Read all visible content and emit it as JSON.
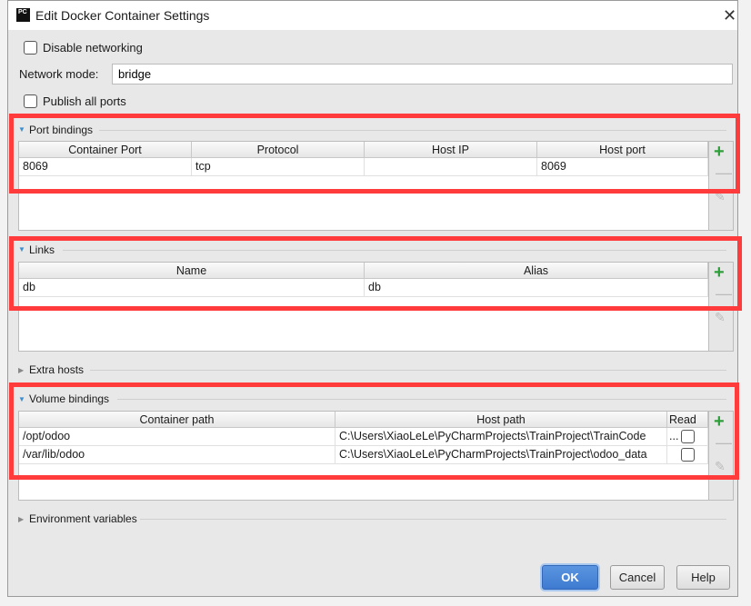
{
  "dialog": {
    "title": "Edit Docker Container Settings",
    "app_icon": "PC",
    "close": "✕"
  },
  "disable_networking": {
    "label": "Disable networking",
    "checked": false
  },
  "network_mode": {
    "label": "Network mode:",
    "value": "bridge"
  },
  "publish_all": {
    "label": "Publish all ports",
    "checked": false
  },
  "port_bindings": {
    "title": "Port bindings",
    "expanded": true,
    "columns": [
      "Container Port",
      "Protocol",
      "Host IP",
      "Host port"
    ],
    "rows": [
      [
        "8069",
        "tcp",
        "",
        "8069"
      ]
    ]
  },
  "links": {
    "title": "Links",
    "expanded": true,
    "columns": [
      "Name",
      "Alias"
    ],
    "rows": [
      [
        "db",
        "db"
      ]
    ]
  },
  "extra_hosts": {
    "title": "Extra hosts",
    "expanded": false
  },
  "volume_bindings": {
    "title": "Volume bindings",
    "expanded": true,
    "columns": [
      "Container path",
      "Host path",
      "Read ..."
    ],
    "rows": [
      [
        "/opt/odoo",
        "C:\\Users\\XiaoLeLe\\PyCharmProjects\\TrainProject\\TrainCode",
        false
      ],
      [
        "/var/lib/odoo",
        "C:\\Users\\XiaoLeLe\\PyCharmProjects\\TrainProject\\odoo_data",
        false
      ]
    ]
  },
  "env_vars": {
    "title": "Environment variables",
    "expanded": false
  },
  "toolbar": {
    "add": "+",
    "remove": "—",
    "edit": "✎"
  },
  "buttons": {
    "ok": "OK",
    "cancel": "Cancel",
    "help": "Help"
  },
  "colors": {
    "highlight": "#ff3b3b",
    "ok_button": "#3e7ad0",
    "add_icon": "#2e9e3a"
  }
}
